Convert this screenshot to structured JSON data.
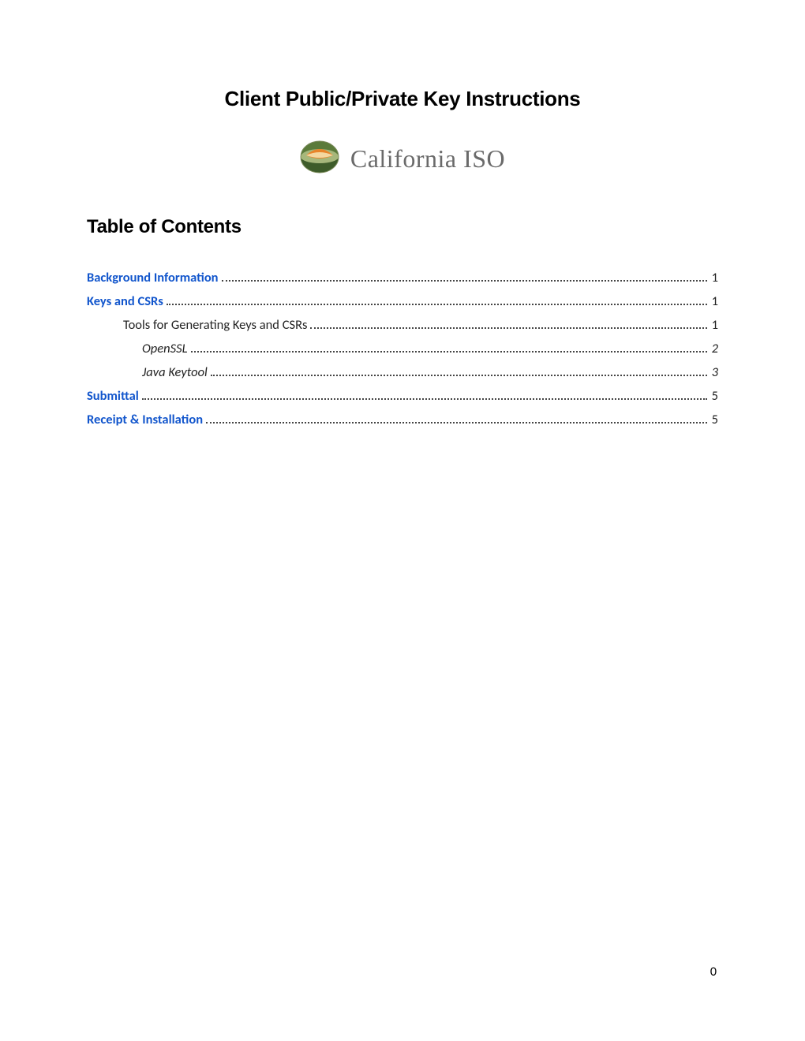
{
  "title": "Client Public/Private Key Instructions",
  "logo": {
    "text": "California ISO"
  },
  "toc_heading": "Table of Contents",
  "toc": [
    {
      "label": "Background Information",
      "page": "1",
      "level": 0,
      "bold": true,
      "link": true
    },
    {
      "label": "Keys and CSRs",
      "page": "1",
      "level": 0,
      "bold": true,
      "link": true
    },
    {
      "label": "Tools for Generating Keys and CSRs",
      "page": "1",
      "level": 1,
      "bold": false,
      "link": false
    },
    {
      "label": "OpenSSL",
      "page": "2",
      "level": 2,
      "bold": false,
      "link": false,
      "italic": true
    },
    {
      "label": "Java Keytool",
      "page": "3",
      "level": 2,
      "bold": false,
      "link": false,
      "italic": true
    },
    {
      "label": "Submittal",
      "page": "5",
      "level": 0,
      "bold": true,
      "link": true
    },
    {
      "label": "Receipt & Installation",
      "page": "5",
      "level": 0,
      "bold": true,
      "link": true
    }
  ],
  "footer_page": "0"
}
